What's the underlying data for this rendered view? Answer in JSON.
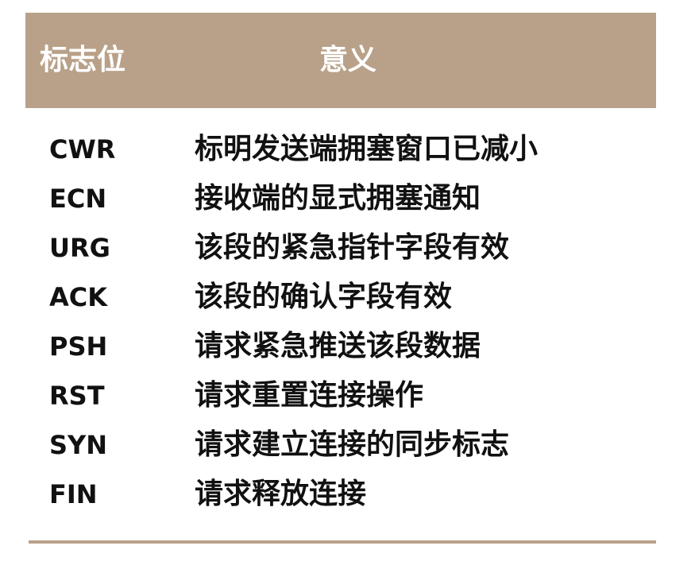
{
  "table": {
    "header": {
      "flag_label": "标志位",
      "meaning_label": "意义",
      "color": "#b9a189"
    },
    "rows": [
      {
        "flag": "CWR",
        "meaning": "标明发送端拥塞窗口已减小"
      },
      {
        "flag": "ECN",
        "meaning": "接收端的显式拥塞通知"
      },
      {
        "flag": "URG",
        "meaning": "该段的紧急指针字段有效"
      },
      {
        "flag": "ACK",
        "meaning": "该段的确认字段有效"
      },
      {
        "flag": "PSH",
        "meaning": "请求紧急推送该段数据"
      },
      {
        "flag": "RST",
        "meaning": "请求重置连接操作"
      },
      {
        "flag": "SYN",
        "meaning": "请求建立连接的同步标志"
      },
      {
        "flag": "FIN",
        "meaning": "请求释放连接"
      }
    ]
  }
}
